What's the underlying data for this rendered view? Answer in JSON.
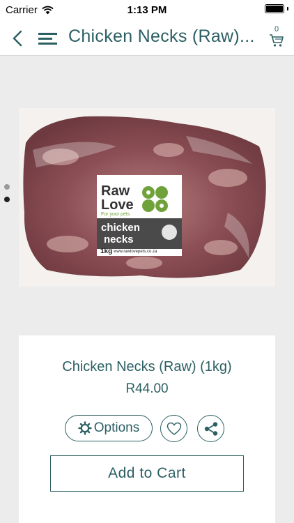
{
  "status_bar": {
    "carrier": "Carrier",
    "time": "1:13 PM"
  },
  "nav": {
    "title": "Chicken Necks (Raw)...",
    "cart_count": "0"
  },
  "gallery": {
    "total_images": 2,
    "active_index": 1
  },
  "product": {
    "name": "Chicken Necks (Raw) (1kg)",
    "price": "R44.00",
    "brand_label": {
      "line1": "Raw",
      "line2": "Love",
      "tagline": "For your pets",
      "product_line1": "chicken",
      "product_line2": "necks",
      "weight": "1kg",
      "website": "www.rawlovepets.co.za"
    }
  },
  "actions": {
    "options_label": "Options",
    "add_to_cart_label": "Add to Cart"
  },
  "colors": {
    "accent": "#2c5f63",
    "background": "#ececec",
    "brand_green": "#6fa23a"
  }
}
